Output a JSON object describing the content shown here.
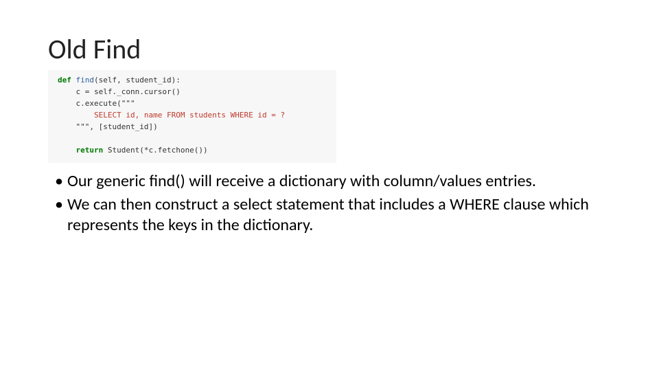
{
  "title": "Old Find",
  "code": {
    "l1_def": "def",
    "l1_fn": "find",
    "l1_params": "(self, student_id):",
    "l2": "c = self._conn.cursor()",
    "l3": "c.execute(\"\"\"",
    "l4_sql": "SELECT id, name FROM students WHERE id = ?",
    "l5": "\"\"\", [student_id])",
    "l7_ret": "return",
    "l7_rest": " Student(*c.fetchone())"
  },
  "bullets": [
    "Our generic find() will receive a dictionary with column/values entries.",
    "We can then construct a select statement that includes a WHERE clause which represents the keys in the dictionary."
  ]
}
